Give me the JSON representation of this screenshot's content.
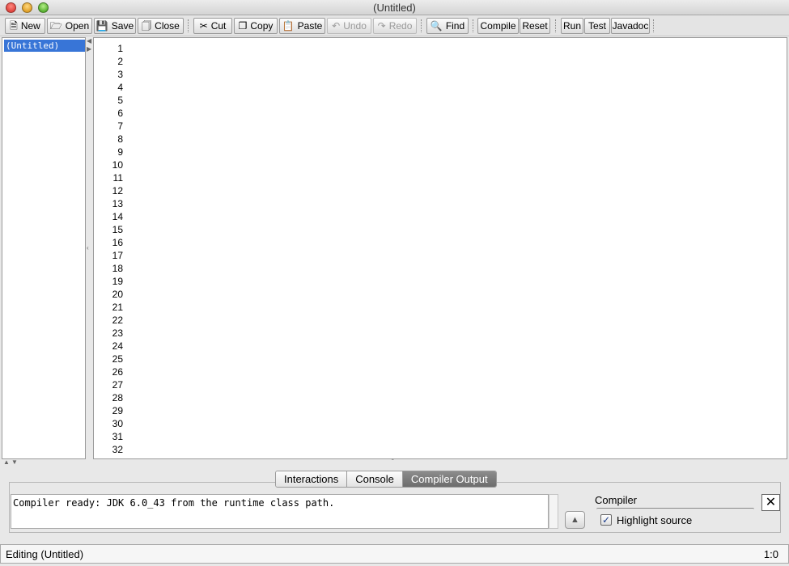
{
  "window": {
    "title": "(Untitled)"
  },
  "toolbar": {
    "new": "New",
    "open": "Open",
    "save": "Save",
    "close": "Close",
    "cut": "Cut",
    "copy": "Copy",
    "paste": "Paste",
    "undo": "Undo",
    "redo": "Redo",
    "find": "Find",
    "compile": "Compile",
    "reset": "Reset",
    "run": "Run",
    "test": "Test",
    "javadoc": "Javadoc"
  },
  "documents": {
    "items": [
      {
        "label": "(Untitled)",
        "selected": true
      }
    ]
  },
  "editor": {
    "line_numbers": [
      "1",
      "2",
      "3",
      "4",
      "5",
      "6",
      "7",
      "8",
      "9",
      "10",
      "11",
      "12",
      "13",
      "14",
      "15",
      "16",
      "17",
      "18",
      "19",
      "20",
      "21",
      "22",
      "23",
      "24",
      "25",
      "26",
      "27",
      "28",
      "29",
      "30",
      "31",
      "32"
    ]
  },
  "tabs": {
    "interactions": "Interactions",
    "console": "Console",
    "compiler_output": "Compiler Output",
    "active": "Compiler Output"
  },
  "output": {
    "message": "Compiler ready: JDK 6.0_43 from the runtime class path."
  },
  "compiler_panel": {
    "label": "Compiler",
    "highlight_label": "Highlight source",
    "highlight_checked": true
  },
  "status": {
    "left": "Editing (Untitled)",
    "right": "1:0"
  },
  "colors": {
    "selection": "#3875d7",
    "active_tab": "#7a7a7a"
  }
}
